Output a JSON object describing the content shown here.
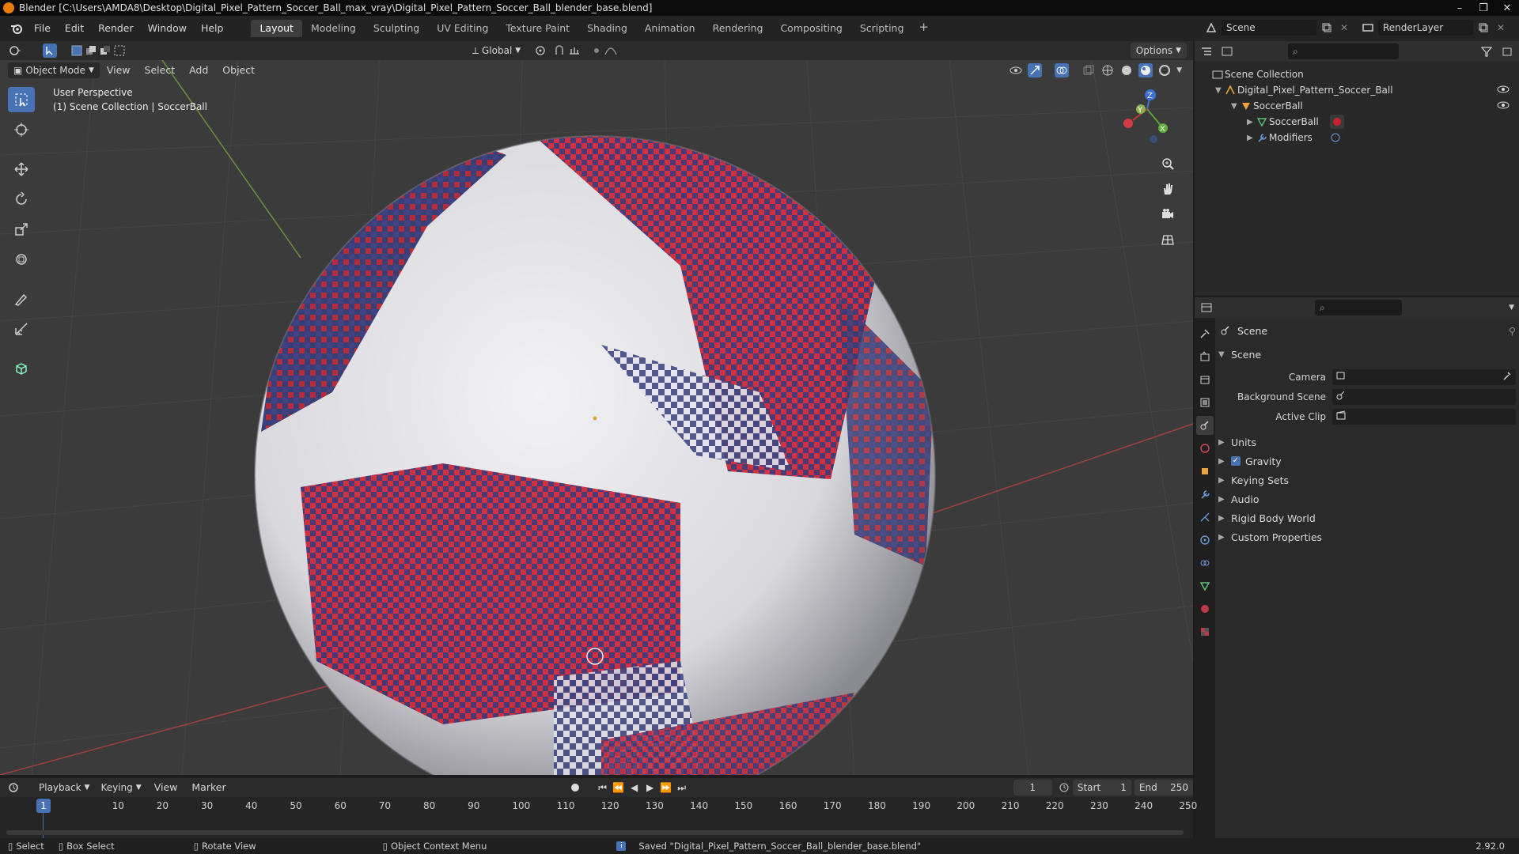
{
  "window": {
    "title": "Blender [C:\\Users\\AMDA8\\Desktop\\Digital_Pixel_Pattern_Soccer_Ball_max_vray\\Digital_Pixel_Pattern_Soccer_Ball_blender_base.blend]"
  },
  "menu": {
    "file": "File",
    "edit": "Edit",
    "render": "Render",
    "window": "Window",
    "help": "Help"
  },
  "workspaces": [
    "Layout",
    "Modeling",
    "Sculpting",
    "UV Editing",
    "Texture Paint",
    "Shading",
    "Animation",
    "Rendering",
    "Compositing",
    "Scripting"
  ],
  "topright": {
    "scene": "Scene",
    "render_layer": "RenderLayer"
  },
  "viewport_header": {
    "orientation": "Global",
    "options": "Options",
    "mode": "Object Mode",
    "view": "View",
    "select": "Select",
    "add": "Add",
    "object": "Object"
  },
  "viewport": {
    "perspective": "User Perspective",
    "collection": "(1) Scene Collection | SoccerBall",
    "gizmo": {
      "z": "Z",
      "y": "Y",
      "x": "X"
    }
  },
  "outliner": {
    "root": "Scene Collection",
    "items": [
      {
        "label": "Digital_Pixel_Pattern_Soccer_Ball"
      },
      {
        "label": "SoccerBall"
      },
      {
        "label": "SoccerBall"
      },
      {
        "label": "Modifiers"
      }
    ]
  },
  "properties": {
    "context": "Scene",
    "section": "Scene",
    "camera_label": "Camera",
    "background_label": "Background Scene",
    "clip_label": "Active Clip",
    "panels": [
      "Units",
      "Gravity",
      "Keying Sets",
      "Audio",
      "Rigid Body World",
      "Custom Properties"
    ]
  },
  "timeline": {
    "playback": "Playback",
    "keying": "Keying",
    "view": "View",
    "marker": "Marker",
    "current_frame": "1",
    "start_label": "Start",
    "start": "1",
    "end_label": "End",
    "end": "250",
    "ticks": [
      "1",
      "10",
      "20",
      "30",
      "40",
      "50",
      "60",
      "70",
      "80",
      "90",
      "100",
      "110",
      "120",
      "130",
      "140",
      "150",
      "160",
      "170",
      "180",
      "190",
      "200",
      "210",
      "220",
      "230",
      "240",
      "250"
    ]
  },
  "status": {
    "select": "Select",
    "box_select": "Box Select",
    "rotate_view": "Rotate View",
    "context_menu": "Object Context Menu",
    "message": "Saved \"Digital_Pixel_Pattern_Soccer_Ball_blender_base.blend\"",
    "version": "2.92.0"
  },
  "colors": {
    "accent": "#4772b3",
    "ball_red": "#c8202c",
    "ball_navy": "#2a2f6b",
    "ball_white": "#e6e6ea"
  }
}
